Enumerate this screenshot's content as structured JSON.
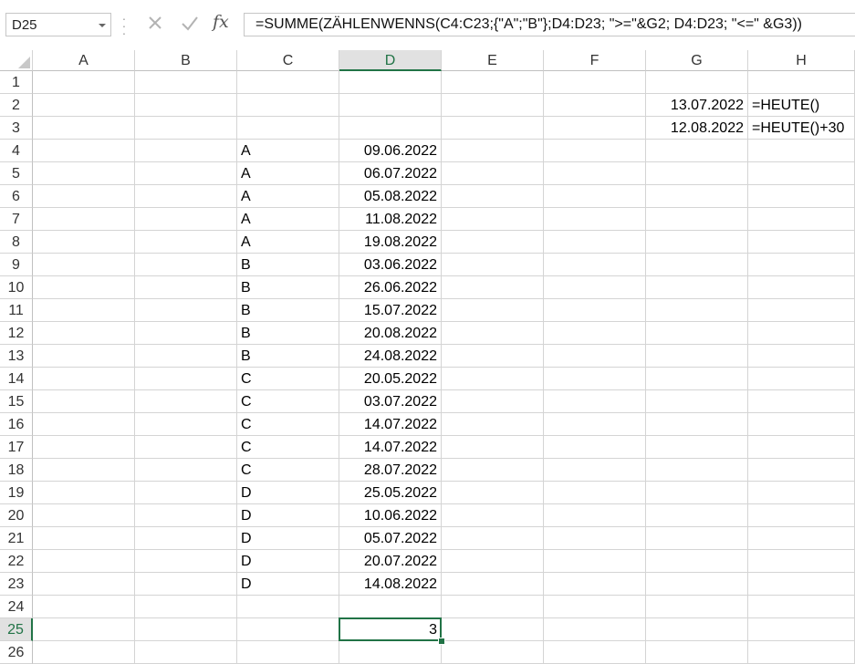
{
  "name_box": {
    "value": "D25"
  },
  "formula_bar": {
    "formula": "=SUMME(ZÄHLENWENNS(C4:C23;{\"A\";\"B\"};D4:D23; \">=\"&G2; D4:D23; \"<=\" &G3))",
    "fx_label": "fx"
  },
  "columns": [
    "A",
    "B",
    "C",
    "D",
    "E",
    "F",
    "G",
    "H"
  ],
  "active_column": "D",
  "active_row": 25,
  "rows": [
    1,
    2,
    3,
    4,
    5,
    6,
    7,
    8,
    9,
    10,
    11,
    12,
    13,
    14,
    15,
    16,
    17,
    18,
    19,
    20,
    21,
    22,
    23,
    24,
    25,
    26
  ],
  "cells": {
    "G2": "13.07.2022",
    "H2": "=HEUTE()",
    "G3": "12.08.2022",
    "H3": "=HEUTE()+30",
    "C4": "A",
    "D4": "09.06.2022",
    "C5": "A",
    "D5": "06.07.2022",
    "C6": "A",
    "D6": "05.08.2022",
    "C7": "A",
    "D7": "11.08.2022",
    "C8": "A",
    "D8": "19.08.2022",
    "C9": "B",
    "D9": "03.06.2022",
    "C10": "B",
    "D10": "26.06.2022",
    "C11": "B",
    "D11": "15.07.2022",
    "C12": "B",
    "D12": "20.08.2022",
    "C13": "B",
    "D13": "24.08.2022",
    "C14": "C",
    "D14": "20.05.2022",
    "C15": "C",
    "D15": "03.07.2022",
    "C16": "C",
    "D16": "14.07.2022",
    "C17": "C",
    "D17": "14.07.2022",
    "C18": "C",
    "D18": "28.07.2022",
    "C19": "D",
    "D19": "25.05.2022",
    "C20": "D",
    "D20": "10.06.2022",
    "C21": "D",
    "D21": "05.07.2022",
    "C22": "D",
    "D22": "20.07.2022",
    "C23": "D",
    "D23": "14.08.2022",
    "D25": "3"
  },
  "colors": {
    "accent": "#217346",
    "gridline": "#d4d4d4",
    "header_active_bg": "#e1e1e1"
  },
  "icons": [
    "dropdown-arrow-icon",
    "more-options-icon",
    "cancel-icon",
    "enter-icon",
    "insert-function-icon"
  ]
}
